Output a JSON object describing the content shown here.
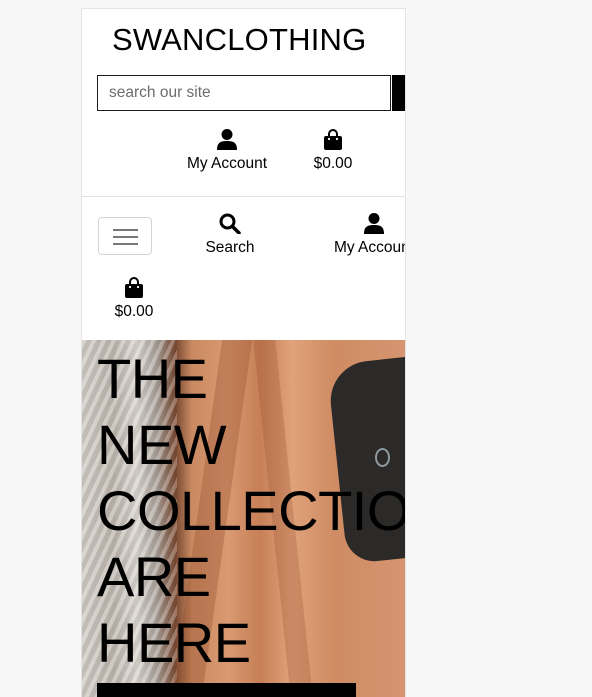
{
  "header": {
    "brand": "SWANCLOTHING",
    "search_placeholder": "search our site",
    "account_label": "My Account",
    "bag_total": "$0.00"
  },
  "mobile_nav": {
    "search_label": "Search",
    "account_label": "My Account",
    "bag_total": "$0.00"
  },
  "hero": {
    "lines": [
      "THE",
      "NEW",
      "COLLECTIONS",
      "ARE",
      "HERE"
    ]
  },
  "icons": {
    "account": "user-icon",
    "bag": "shopping-bag-icon",
    "search": "magnifier-icon",
    "menu": "hamburger-icon"
  }
}
